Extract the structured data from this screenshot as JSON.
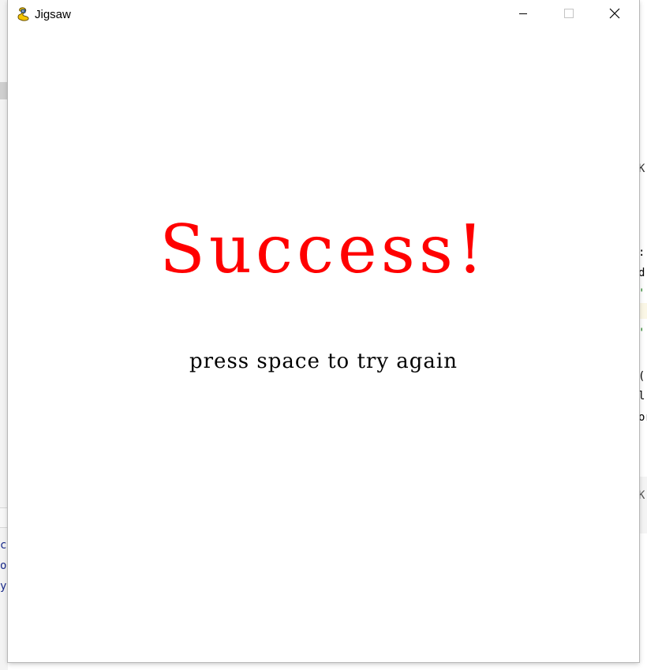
{
  "window": {
    "title": "Jigsaw",
    "icon": "pygame-snake-icon"
  },
  "controls": {
    "minimize": "minimize-icon",
    "maximize": "maximize-icon",
    "close": "close-icon"
  },
  "game": {
    "message": "Success!",
    "hint": "press space to try again",
    "message_color": "#ff0000",
    "hint_color": "#000000"
  },
  "background": {
    "right_fragments": [
      "K",
      ":",
      "d:",
      "';",
      "_",
      "';",
      "_",
      "(",
      "l,",
      "or",
      "K"
    ],
    "left_fragments": [
      "ce",
      "or",
      "y."
    ]
  }
}
